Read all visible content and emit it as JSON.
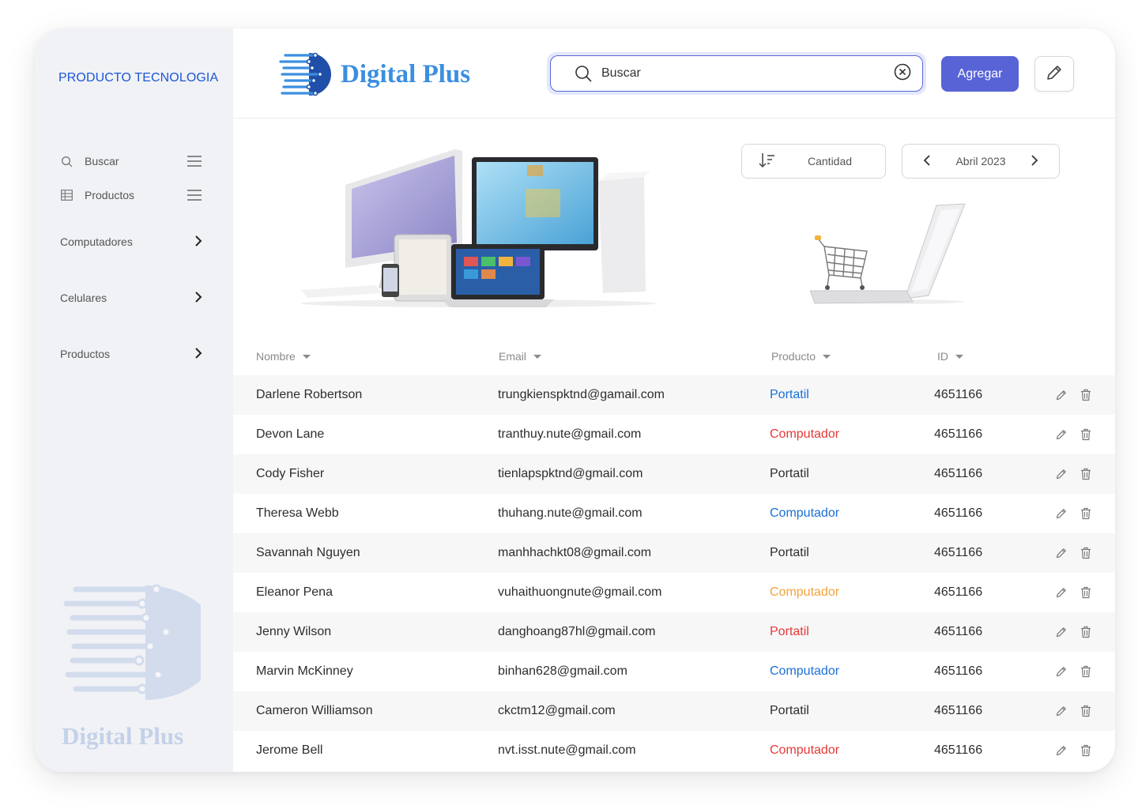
{
  "sidebar": {
    "brand": "PRODUCTO TECNOLOGIA",
    "menu": [
      {
        "label": "Buscar",
        "icon": "search-icon"
      },
      {
        "label": "Productos",
        "icon": "grid-icon"
      }
    ],
    "categories": [
      {
        "label": "Computadores"
      },
      {
        "label": "Celulares"
      },
      {
        "label": "Productos"
      }
    ],
    "watermark": "Digital Plus"
  },
  "header": {
    "logo_text": "Digital Plus",
    "search_placeholder": "Buscar",
    "add_label": "Agregar"
  },
  "controls": {
    "sort_label": "Cantidad",
    "month_label": "Abril 2023"
  },
  "table": {
    "columns": [
      "Nombre",
      "Email",
      "Producto",
      "ID"
    ],
    "rows": [
      {
        "name": "Darlene Robertson",
        "email": "trungkienspktnd@gamail.com",
        "product": "Portatil",
        "product_color": "#1a6fd6",
        "id": "4651166"
      },
      {
        "name": "Devon Lane",
        "email": "tranthuy.nute@gmail.com",
        "product": "Computador",
        "product_color": "#e53935",
        "id": "4651166"
      },
      {
        "name": "Cody Fisher",
        "email": "tienlapspktnd@gmail.com",
        "product": "Portatil",
        "product_color": "#2d2d2d",
        "id": "4651166"
      },
      {
        "name": "Theresa Webb",
        "email": "thuhang.nute@gmail.com",
        "product": "Computador",
        "product_color": "#1a6fd6",
        "id": "4651166"
      },
      {
        "name": "Savannah Nguyen",
        "email": "manhhachkt08@gmail.com",
        "product": "Portatil",
        "product_color": "#2d2d2d",
        "id": "4651166"
      },
      {
        "name": "Eleanor Pena",
        "email": "vuhaithuongnute@gmail.com",
        "product": "Computador",
        "product_color": "#f4a23a",
        "id": "4651166"
      },
      {
        "name": "Jenny Wilson",
        "email": "danghoang87hl@gmail.com",
        "product": "Portatil",
        "product_color": "#e53935",
        "id": "4651166"
      },
      {
        "name": "Marvin McKinney",
        "email": "binhan628@gmail.com",
        "product": "Computador",
        "product_color": "#1a6fd6",
        "id": "4651166"
      },
      {
        "name": "Cameron Williamson",
        "email": "ckctm12@gmail.com",
        "product": "Portatil",
        "product_color": "#2d2d2d",
        "id": "4651166"
      },
      {
        "name": "Jerome Bell",
        "email": "nvt.isst.nute@gmail.com",
        "product": "Computador",
        "product_color": "#e53935",
        "id": "4651166"
      }
    ]
  },
  "colors": {
    "accent": "#5864d6",
    "brand_blue": "#1a56d6",
    "sidebar_bg": "#f1f2f6"
  }
}
